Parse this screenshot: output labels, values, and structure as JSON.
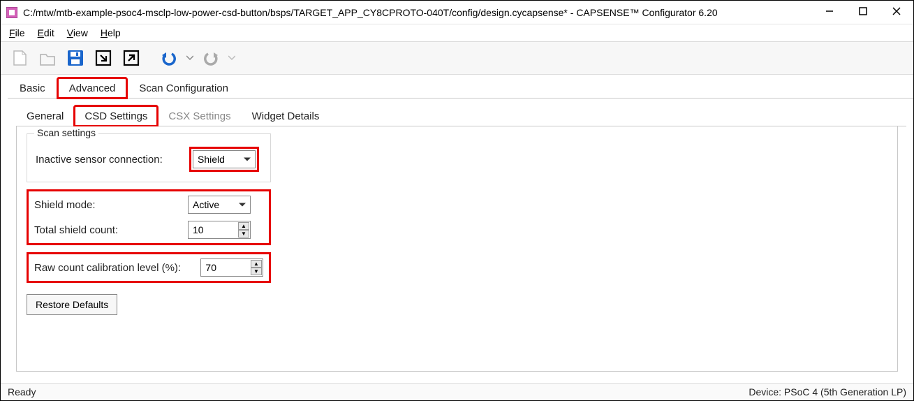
{
  "window": {
    "title": "C:/mtw/mtb-example-psoc4-msclp-low-power-csd-button/bsps/TARGET_APP_CY8CPROTO-040T/config/design.cycapsense* - CAPSENSE™ Configurator 6.20"
  },
  "menubar": {
    "file": "File",
    "edit": "Edit",
    "view": "View",
    "help": "Help"
  },
  "tabs": {
    "basic": "Basic",
    "advanced": "Advanced",
    "scan_config": "Scan Configuration"
  },
  "inner_tabs": {
    "general": "General",
    "csd": "CSD Settings",
    "csx": "CSX Settings",
    "widget": "Widget Details"
  },
  "fieldset": {
    "legend": "Scan settings",
    "inactive_label": "Inactive sensor connection:",
    "inactive_value": "Shield"
  },
  "shield_mode": {
    "label": "Shield mode:",
    "value": "Active"
  },
  "total_shield": {
    "label": "Total shield count:",
    "value": "10"
  },
  "raw_cal": {
    "label": "Raw count calibration level (%):",
    "value": "70"
  },
  "restore": "Restore Defaults",
  "status": {
    "left": "Ready",
    "right": "Device: PSoC 4 (5th Generation LP)"
  }
}
